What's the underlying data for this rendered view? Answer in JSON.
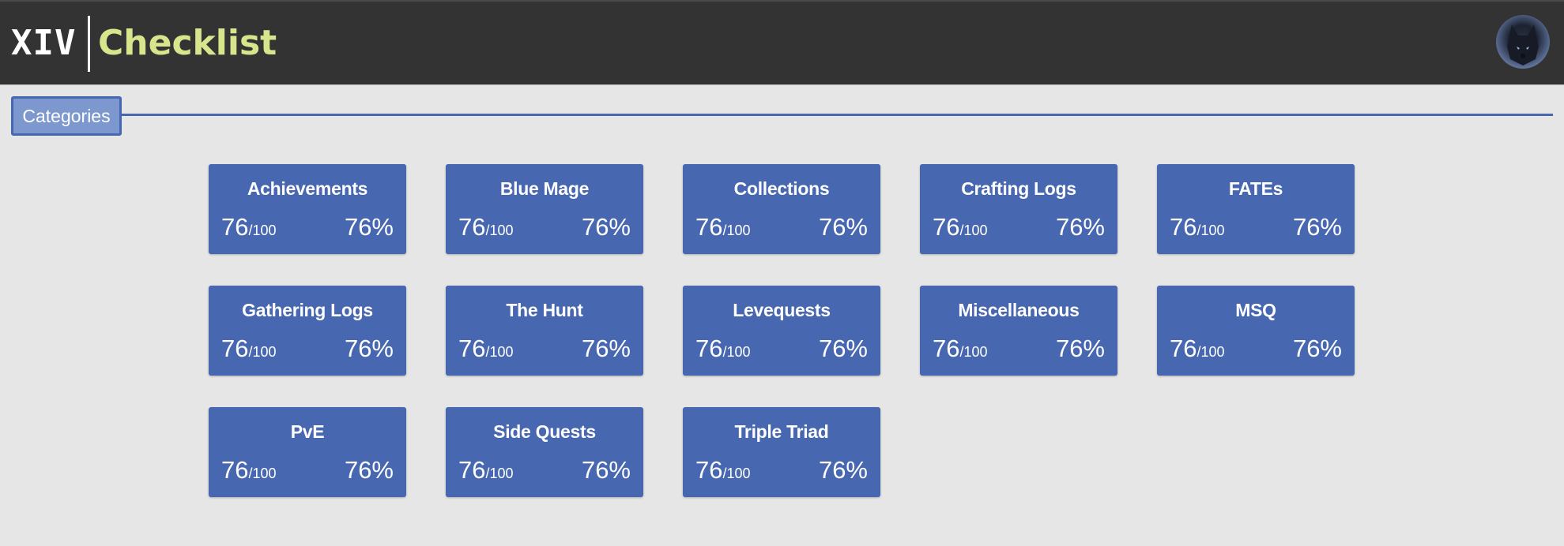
{
  "header": {
    "brand_prefix": "XIV",
    "brand_name": "Checklist"
  },
  "categories": {
    "label": "Categories"
  },
  "colors": {
    "header_bg": "#333333",
    "brand_accent": "#d8e58c",
    "card_bg": "#4767b1",
    "tab_bg": "#7d97cf",
    "page_bg": "#e6e6e6"
  },
  "cards": [
    {
      "title": "Achievements",
      "count": "76",
      "total": "/100",
      "percent": "76%"
    },
    {
      "title": "Blue Mage",
      "count": "76",
      "total": "/100",
      "percent": "76%"
    },
    {
      "title": "Collections",
      "count": "76",
      "total": "/100",
      "percent": "76%"
    },
    {
      "title": "Crafting Logs",
      "count": "76",
      "total": "/100",
      "percent": "76%"
    },
    {
      "title": "FATEs",
      "count": "76",
      "total": "/100",
      "percent": "76%"
    },
    {
      "title": "Gathering Logs",
      "count": "76",
      "total": "/100",
      "percent": "76%"
    },
    {
      "title": "The Hunt",
      "count": "76",
      "total": "/100",
      "percent": "76%"
    },
    {
      "title": "Levequests",
      "count": "76",
      "total": "/100",
      "percent": "76%"
    },
    {
      "title": "Miscellaneous",
      "count": "76",
      "total": "/100",
      "percent": "76%"
    },
    {
      "title": "MSQ",
      "count": "76",
      "total": "/100",
      "percent": "76%"
    },
    {
      "title": "PvE",
      "count": "76",
      "total": "/100",
      "percent": "76%"
    },
    {
      "title": "Side Quests",
      "count": "76",
      "total": "/100",
      "percent": "76%"
    },
    {
      "title": "Triple Triad",
      "count": "76",
      "total": "/100",
      "percent": "76%"
    }
  ]
}
